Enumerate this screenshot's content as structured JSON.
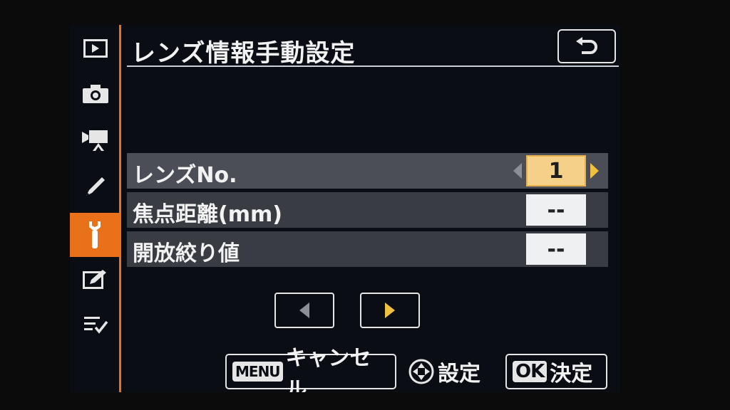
{
  "header": {
    "title": "レンズ情報手動設定",
    "back_icon": "return-icon"
  },
  "sidebar": {
    "items": [
      {
        "icon": "playback-icon"
      },
      {
        "icon": "camera-icon"
      },
      {
        "icon": "movie-icon"
      },
      {
        "icon": "pencil-icon"
      },
      {
        "icon": "wrench-icon",
        "active": true
      },
      {
        "icon": "retouch-icon"
      },
      {
        "icon": "my-menu-icon"
      }
    ]
  },
  "rows": [
    {
      "label": "レンズNo.",
      "value": "1",
      "selected": true
    },
    {
      "label": "焦点距離(mm)",
      "value": "--",
      "selected": false
    },
    {
      "label": "開放絞り値",
      "value": "--",
      "selected": false
    }
  ],
  "footer": {
    "menu_tag": "MENU",
    "cancel_label": "キャンセル",
    "set_label": "設定",
    "ok_tag": "OK",
    "confirm_label": "決定"
  },
  "colors": {
    "accent": "#e8711a",
    "selection": "#f4d089",
    "background": "#0a0d14"
  }
}
